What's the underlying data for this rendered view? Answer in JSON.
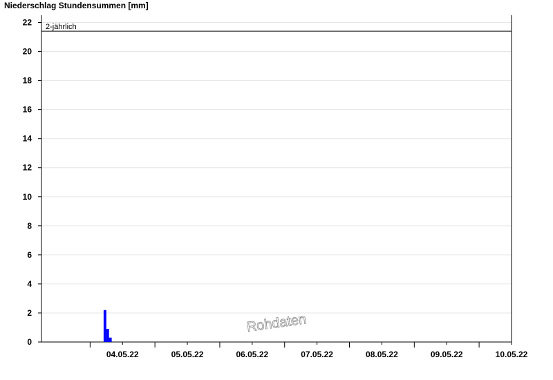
{
  "chart_data": {
    "type": "bar",
    "title": "Niederschlag Stundensummen [mm]",
    "xlabel": "",
    "ylabel": "",
    "ylim": [
      0,
      22.5
    ],
    "yticks": [
      0,
      2,
      4,
      6,
      8,
      10,
      12,
      14,
      16,
      18,
      20,
      22
    ],
    "xlim": [
      "2022-05-03T06:00",
      "2022-05-10T12:00"
    ],
    "xticks": [
      {
        "date": "2022-05-04T12:00",
        "label": "04.05.22"
      },
      {
        "date": "2022-05-05T12:00",
        "label": "05.05.22"
      },
      {
        "date": "2022-05-06T12:00",
        "label": "06.05.22"
      },
      {
        "date": "2022-05-07T12:00",
        "label": "07.05.22"
      },
      {
        "date": "2022-05-08T12:00",
        "label": "08.05.22"
      },
      {
        "date": "2022-05-09T12:00",
        "label": "09.05.22"
      },
      {
        "date": "2022-05-10T12:00",
        "label": "10.05.22"
      }
    ],
    "grid": true,
    "series": [
      {
        "color": "#0000ff",
        "points": [
          {
            "x": "2022-05-04T05:00",
            "y": 2.2
          },
          {
            "x": "2022-05-04T06:00",
            "y": 0.9
          },
          {
            "x": "2022-05-04T07:00",
            "y": 0.3
          }
        ]
      }
    ],
    "reference_lines": [
      {
        "label": "2-jährlich",
        "y": 21.4
      }
    ],
    "watermark": "Rohdaten"
  }
}
